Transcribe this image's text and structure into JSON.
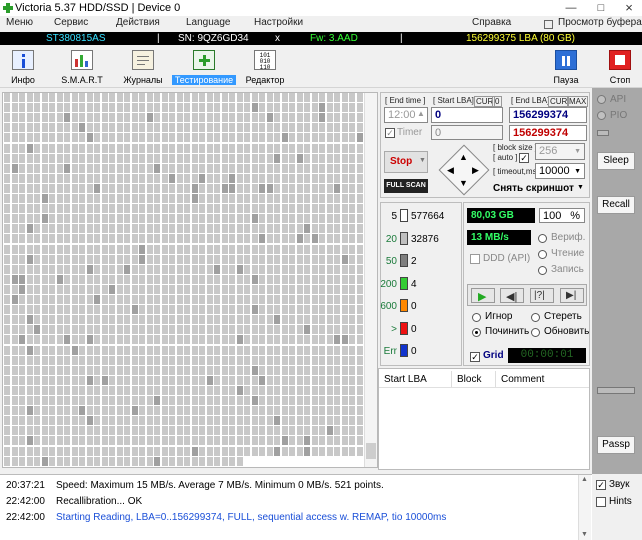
{
  "window": {
    "title": "Victoria 5.37 HDD/SSD | Device 0"
  },
  "menu": [
    "Меню",
    "Сервис",
    "Действия",
    "Language",
    "Настройки",
    "Справка",
    "Просмотр буфера"
  ],
  "info": {
    "model": "ST380815AS",
    "serial": "SN: 9QZ6GD34",
    "x": "x",
    "fw": "Fw: 3.AAD",
    "lba": "156299375 LBA (80 GB)"
  },
  "toolbar": {
    "info": "Инфо",
    "smart": "S.M.A.R.T",
    "journals": "Журналы",
    "testing": "Тестирование",
    "editor": "Редактор",
    "pause": "Пауза",
    "stop": "Стоп"
  },
  "scan": {
    "end_time_label": "[ End time ]",
    "end_time": "12:00",
    "timer_label": "Timer",
    "timer_value": "0",
    "start_lba_label": "[ Start LBA]",
    "cur_label": "CUR",
    "zero_label": "0",
    "start_lba": "0",
    "start_lba2": "0",
    "end_lba_label": "[ End LBA]",
    "cur2_label": "CUR",
    "max_label": "MAX",
    "end_lba": "156299374",
    "end_lba2": "156299374",
    "stop_button": "Stop",
    "full_scan": "FULL SCAN",
    "block_size_label": "[ block size ]",
    "auto_label": "[ auto ]",
    "block_size": "256",
    "timeout_label": "[ timeout,ms ]",
    "timeout": "10000",
    "screenshot": "Снять скриншот"
  },
  "legend": [
    {
      "ms": "5",
      "count": "577664",
      "color": "#ffffff"
    },
    {
      "ms": "20",
      "count": "32876",
      "color": "#bfbfbf"
    },
    {
      "ms": "50",
      "count": "2",
      "color": "#7f7f7f"
    },
    {
      "ms": "200",
      "count": "4",
      "color": "#33cc33"
    },
    {
      "ms": "600",
      "count": "0",
      "color": "#ff8800"
    },
    {
      "ms": ">",
      "count": "0",
      "color": "#ee1111"
    },
    {
      "ms": "Err",
      "count": "0",
      "color": "#1133cc"
    }
  ],
  "stats": {
    "size": "80,03 GB",
    "percent": "100",
    "percent_unit": "%",
    "speed": "13 MB/s",
    "ddd": "DDD (API)",
    "verify": "Вериф.",
    "read": "Чтение",
    "write": "Запись",
    "ignore": "Игнор",
    "erase": "Стереть",
    "repair": "Починить",
    "refresh": "Обновить",
    "grid": "Grid",
    "elapsed": "00:00:01"
  },
  "table": {
    "headers": [
      "Start LBA",
      "Block",
      "Comment"
    ]
  },
  "side": {
    "api": "API",
    "pio": "PIO",
    "sleep": "Sleep",
    "recall": "Recall",
    "passp": "Passp"
  },
  "log": [
    {
      "time": "20:37:21",
      "msg": "Speed: Maximum 15 MB/s. Average 7 MB/s. Minimum 0 MB/s. 521 points.",
      "color": "#000000"
    },
    {
      "time": "22:42:00",
      "msg": "Recallibration... OK",
      "color": "#000000"
    },
    {
      "time": "22:42:00",
      "msg": "Starting Reading, LBA=0..156299374, FULL, sequential access w. REMAP, tio 10000ms",
      "color": "#1a4fd8"
    }
  ],
  "options": {
    "sound": "Звук",
    "hints": "Hints"
  }
}
